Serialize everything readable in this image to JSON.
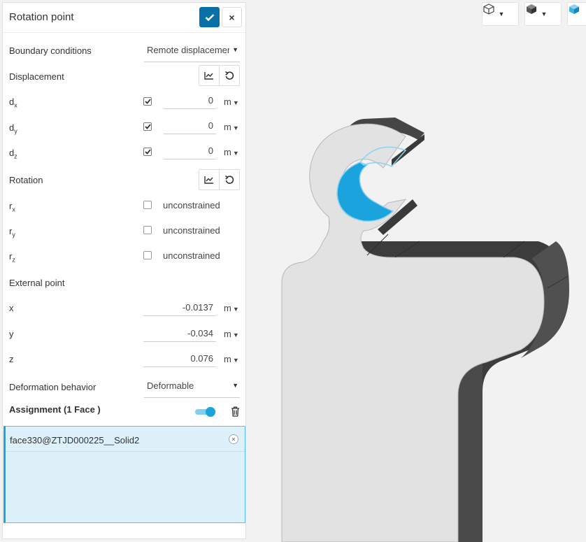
{
  "panel": {
    "title": "Rotation point",
    "boundary_label": "Boundary conditions",
    "boundary_value": "Remote displacement",
    "displacement_label": "Displacement",
    "rotation_label": "Rotation",
    "external_label": "External point",
    "deformation_label": "Deformation behavior",
    "deformation_value": "Deformable",
    "displacement": [
      {
        "axis": "d",
        "sub": "x",
        "checked": true,
        "value": "0",
        "unit": "m"
      },
      {
        "axis": "d",
        "sub": "y",
        "checked": true,
        "value": "0",
        "unit": "m"
      },
      {
        "axis": "d",
        "sub": "z",
        "checked": true,
        "value": "0",
        "unit": "m"
      }
    ],
    "rotation": [
      {
        "axis": "r",
        "sub": "x",
        "checked": false,
        "text": "unconstrained"
      },
      {
        "axis": "r",
        "sub": "y",
        "checked": false,
        "text": "unconstrained"
      },
      {
        "axis": "r",
        "sub": "z",
        "checked": false,
        "text": "unconstrained"
      }
    ],
    "external_point": [
      {
        "axis": "x",
        "value": "-0.0137",
        "unit": "m"
      },
      {
        "axis": "y",
        "value": "-0.034",
        "unit": "m"
      },
      {
        "axis": "z",
        "value": "0.076",
        "unit": "m"
      }
    ],
    "assignment_title": "Assignment (1 Face )",
    "assignment_item": "face330@ZTJD000225__Solid2"
  },
  "colors": {
    "accent": "#0a70a8",
    "selection": "#1aa3dd",
    "assign_bg": "#dcf1f9"
  },
  "icons": {
    "confirm": "check-icon",
    "close": "close-icon",
    "chart": "chart-line-icon",
    "reset": "undo-icon",
    "trash": "trash-icon",
    "view_wire": "cube-outline-icon",
    "view_solid": "cube-solid-icon"
  }
}
